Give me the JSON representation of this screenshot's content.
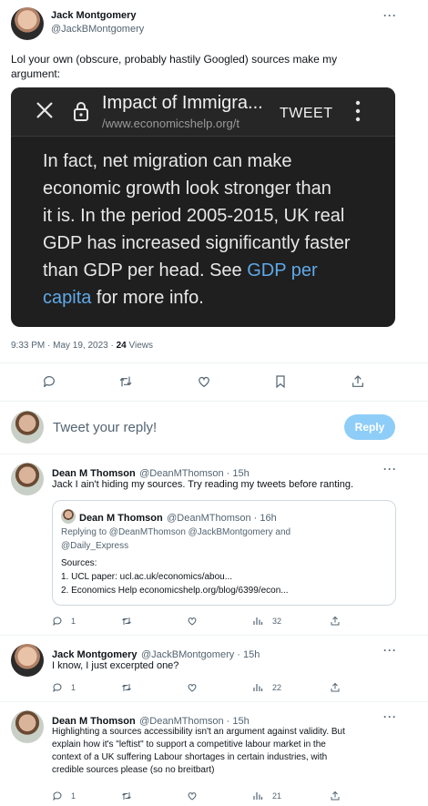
{
  "main_tweet": {
    "author_name": "Jack Montgomery",
    "author_handle": "@JackBMontgomery",
    "text_line1": "Lol your own (obscure, probably hastily Googled) sources make my",
    "text_line2": "argument:",
    "embedded_screenshot": {
      "title": "Impact of Immigra...",
      "url": "/www.economicshelp.org/t",
      "tweet_label": "TWEET",
      "body_lines": [
        "In fact, net migration can make",
        "economic growth look stronger than",
        "it is.  In the period 2005-2015, UK real",
        "GDP has increased significantly faster",
        "than GDP per head. See "
      ],
      "link_part1": "GDP per",
      "link_part2": "capita",
      "body_tail": " for more info."
    },
    "time_date": "9:33 PM · May 19, 2023 · ",
    "views_count": "24",
    "views_label": " Views"
  },
  "reply_box": {
    "placeholder": "Tweet your reply!",
    "button_label": "Reply"
  },
  "replies": [
    {
      "author_name": "Dean M Thomson",
      "author_handle": "@DeanMThomson",
      "time": " · 15h",
      "text": "Jack I ain't hiding my sources. Try reading my tweets before ranting.",
      "quote": {
        "author_name": "Dean M Thomson",
        "author_handle": "@DeanMThomson",
        "time": " · 16h",
        "replying_line1": "Replying to @DeanMThomson @JackBMontgomery and",
        "replying_line2": "@Daily_Express",
        "line1": "Sources:",
        "line2": "1. UCL paper: ucl.ac.uk/economics/abou...",
        "line3": "2. Economics Help economicshelp.org/blog/6399/econ..."
      },
      "reply_count": "1",
      "views_count": "32"
    },
    {
      "author_name": "Jack Montgomery",
      "author_handle": "@JackBMontgomery",
      "time": " · 15h",
      "text": "I know, I just excerpted one?",
      "reply_count": "1",
      "views_count": "22"
    },
    {
      "author_name": "Dean M Thomson",
      "author_handle": "@DeanMThomson",
      "time": " · 15h",
      "text_lines": [
        "Highlighting a sources accessibility isn't an argument against validity. But",
        "explain how it's \"leftist\" to support a competitive labour market in the",
        "context of a UK suffering Labour shortages in certain industries, with",
        "credible sources please (so no breitbart)"
      ],
      "reply_count": "1",
      "views_count": "21"
    }
  ],
  "icons": [
    "more-icon",
    "close-icon",
    "lock-icon",
    "reply-icon",
    "retweet-icon",
    "like-icon",
    "bookmark-icon",
    "share-icon",
    "views-icon"
  ],
  "colors": {
    "accent": "#1d9bf0",
    "reply_button": "#8ecdf8",
    "link_in_screenshot": "#5fa8e8",
    "screenshot_bg": "#1f1f1f"
  }
}
